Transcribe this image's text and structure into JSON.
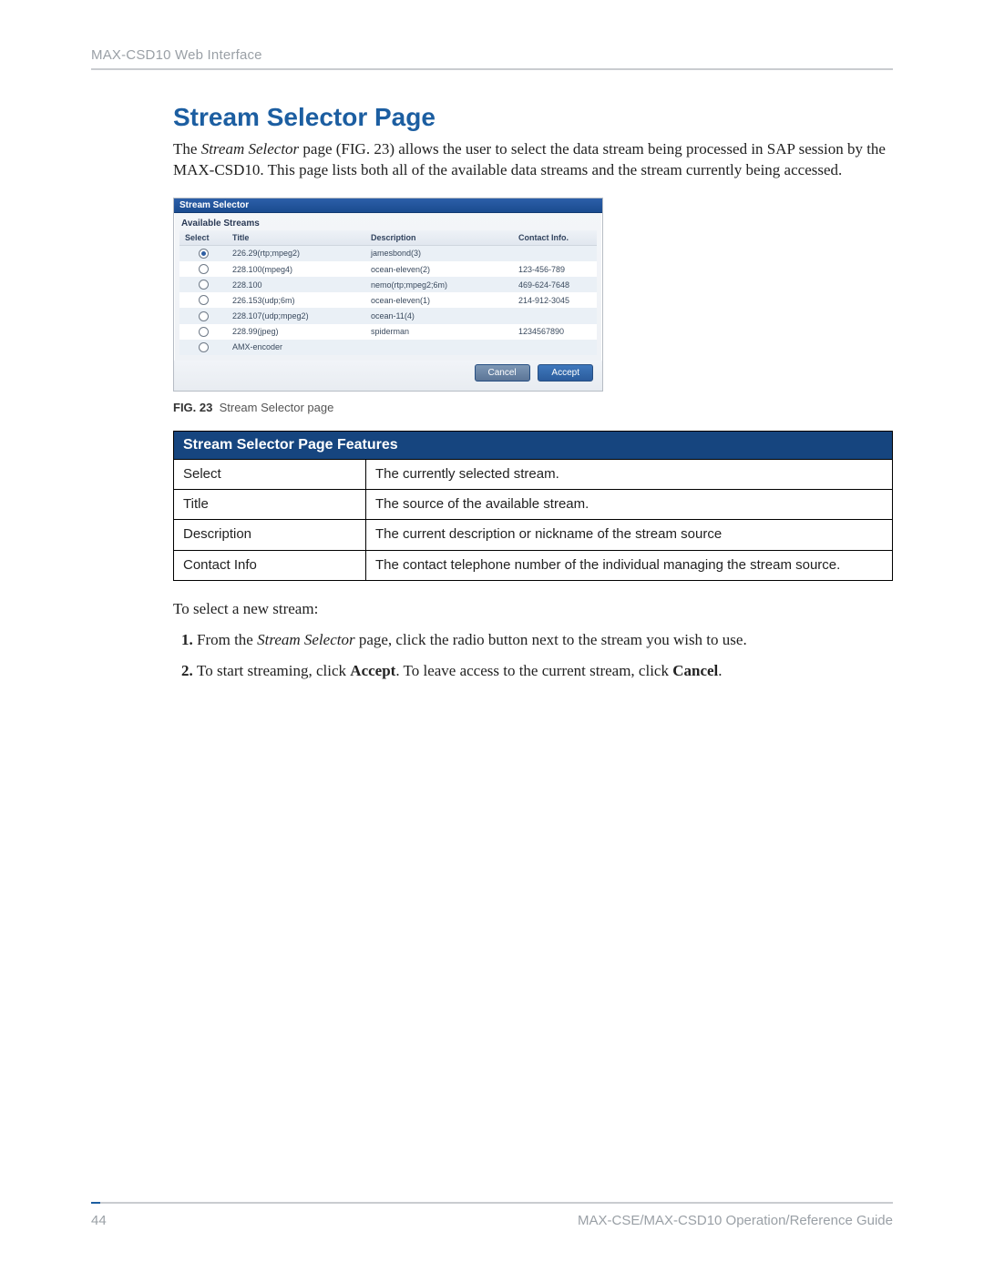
{
  "header": {
    "section": "MAX-CSD10 Web Interface"
  },
  "title": "Stream Selector Page",
  "intro": {
    "t1": "The ",
    "t2": "Stream Selector",
    "t3": " page (FIG. 23) allows the user to select the data stream being processed in SAP session by the MAX-CSD10. This page lists both all of the available data streams and the stream currently being accessed."
  },
  "screenshot": {
    "titlebar": "Stream Selector",
    "subhead": "Available Streams",
    "cols": {
      "select": "Select",
      "title": "Title",
      "desc": "Description",
      "contact": "Contact Info."
    },
    "rows": [
      {
        "selected": true,
        "title": "226.29(rtp;mpeg2)",
        "desc": "jamesbond(3)",
        "contact": ""
      },
      {
        "selected": false,
        "title": "228.100(mpeg4)",
        "desc": "ocean-eleven(2)",
        "contact": "123-456-789"
      },
      {
        "selected": false,
        "title": "228.100",
        "desc": "nemo(rtp;mpeg2;6m)",
        "contact": "469-624-7648"
      },
      {
        "selected": false,
        "title": "226.153(udp;6m)",
        "desc": "ocean-eleven(1)",
        "contact": "214-912-3045"
      },
      {
        "selected": false,
        "title": "228.107(udp;mpeg2)",
        "desc": "ocean-11(4)",
        "contact": ""
      },
      {
        "selected": false,
        "title": "228.99(jpeg)",
        "desc": "spiderman",
        "contact": "1234567890"
      },
      {
        "selected": false,
        "title": "AMX-encoder",
        "desc": "",
        "contact": ""
      }
    ],
    "buttons": {
      "cancel": "Cancel",
      "accept": "Accept"
    }
  },
  "figure": {
    "label": "FIG. 23",
    "caption": "Stream Selector page"
  },
  "featuresTable": {
    "heading": "Stream Selector Page Features",
    "rows": [
      {
        "k": "Select",
        "v": "The currently selected stream."
      },
      {
        "k": "Title",
        "v": "The source of the available stream."
      },
      {
        "k": "Description",
        "v": "The current description or nickname of the stream source"
      },
      {
        "k": "Contact Info",
        "v": "The contact telephone number of the individual managing the stream source."
      }
    ]
  },
  "instructions": {
    "lead": "To select a new stream:",
    "s1a": "From the ",
    "s1b": "Stream Selector",
    "s1c": " page, click the radio button next to the stream you wish to use.",
    "s2a": "To start streaming, click ",
    "s2b": "Accept",
    "s2c": ". To leave access to the current stream, click ",
    "s2d": "Cancel",
    "s2e": "."
  },
  "footer": {
    "page": "44",
    "guide": "MAX-CSE/MAX-CSD10 Operation/Reference Guide"
  }
}
